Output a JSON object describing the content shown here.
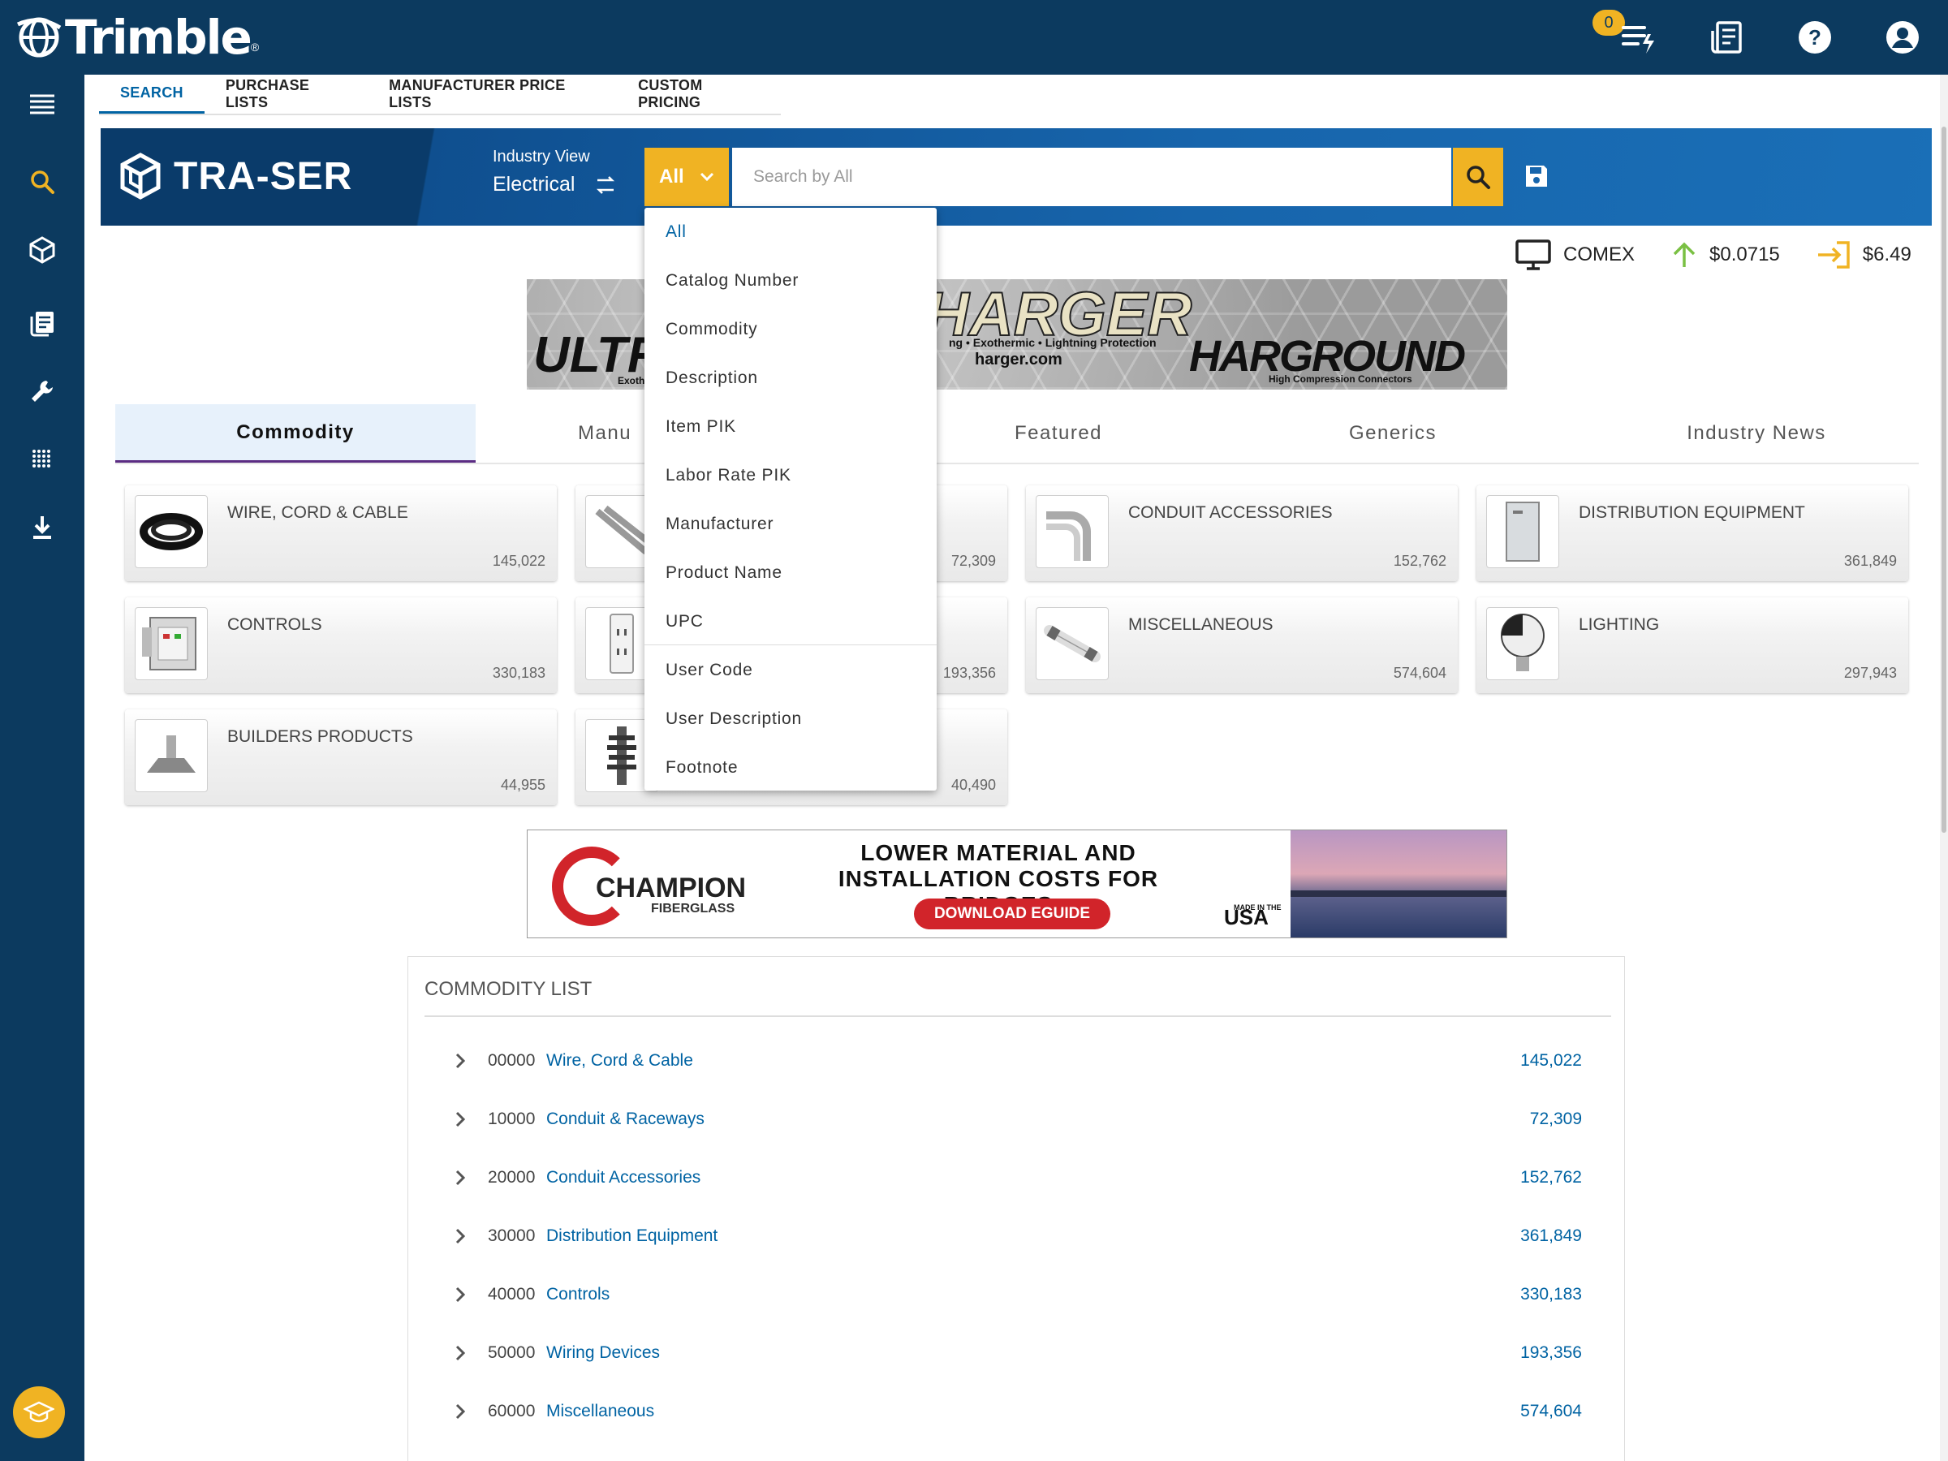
{
  "header": {
    "brand": "Trimble",
    "brand_mark": "®",
    "notification_count": "0",
    "icons": [
      "task-list-icon",
      "news-icon",
      "help-icon",
      "account-icon"
    ]
  },
  "sidebar": {
    "items": [
      "menu-icon",
      "search-icon",
      "cube-icon",
      "catalog-icon",
      "wrench-icon",
      "dots-grid-icon",
      "download-icon"
    ],
    "bottom": "graduation-cap-icon"
  },
  "nav_tabs": [
    {
      "label": "SEARCH",
      "active": true
    },
    {
      "label": "PURCHASE LISTS",
      "active": false
    },
    {
      "label": "MANUFACTURER PRICE LISTS",
      "active": false
    },
    {
      "label": "CUSTOM PRICING",
      "active": false
    }
  ],
  "banner": {
    "brand": "TRA-SER",
    "industry_label": "Industry View",
    "industry_value": "Electrical",
    "scope": "All",
    "search_placeholder": "Search by All"
  },
  "ticker": {
    "comex_label": "COMEX",
    "copper_price": "$0.0715",
    "other_price": "$6.49"
  },
  "dropdown": {
    "selected": "All",
    "options": [
      "All",
      "Catalog Number",
      "Commodity",
      "Description",
      "Item PIK",
      "Labor Rate PIK",
      "Manufacturer",
      "Product Name",
      "UPC",
      "User Code",
      "User Description",
      "Footnote"
    ]
  },
  "ads": {
    "top": {
      "left_word": "ULTR",
      "center_word": "HARGER",
      "center_tagline": "ng • Exothermic • Lightning Protection",
      "center_url": "harger.com",
      "right_word": "HARGROUND",
      "right_tagline": "High Compression Connectors",
      "cut_text": "Exoth"
    },
    "bottom": {
      "brand": "CHAMPION",
      "brand_sub": "FIBERGLASS",
      "headline": "LOWER MATERIAL AND INSTALLATION COSTS FOR BRIDGES",
      "cta": "DOWNLOAD EGUIDE",
      "made_in": "MADE IN THE",
      "usa": "USA"
    }
  },
  "category_tabs": [
    {
      "label": "Commodity",
      "active": true
    },
    {
      "label": "Manu",
      "active": false
    },
    {
      "label": "Featured",
      "active": false
    },
    {
      "label": "Generics",
      "active": false
    },
    {
      "label": "Industry News",
      "active": false
    }
  ],
  "cards": [
    {
      "name": "WIRE, CORD & CABLE",
      "count": "145,022",
      "icon": "wire-coil-icon"
    },
    {
      "name": "",
      "count": "72,309",
      "icon": "conduit-icon"
    },
    {
      "name": "CONDUIT ACCESSORIES",
      "count": "152,762",
      "icon": "conduit-elbow-icon"
    },
    {
      "name": "DISTRIBUTION EQUIPMENT",
      "count": "361,849",
      "icon": "panel-cabinet-icon"
    },
    {
      "name": "CONTROLS",
      "count": "330,183",
      "icon": "control-box-icon"
    },
    {
      "name": "",
      "count": "193,356",
      "icon": "outlet-icon"
    },
    {
      "name": "MISCELLANEOUS",
      "count": "574,604",
      "icon": "fuse-icon"
    },
    {
      "name": "LIGHTING",
      "count": "297,943",
      "icon": "light-bulb-icon"
    },
    {
      "name": "BUILDERS PRODUCTS",
      "count": "44,955",
      "icon": "vent-hood-icon"
    },
    {
      "name": "",
      "count": "40,490",
      "icon": "insulator-icon"
    }
  ],
  "commodity_list": {
    "title": "COMMODITY LIST",
    "rows": [
      {
        "code": "00000",
        "label": "Wire, Cord & Cable",
        "count": "145,022"
      },
      {
        "code": "10000",
        "label": "Conduit & Raceways",
        "count": "72,309"
      },
      {
        "code": "20000",
        "label": "Conduit Accessories",
        "count": "152,762"
      },
      {
        "code": "30000",
        "label": "Distribution Equipment",
        "count": "361,849"
      },
      {
        "code": "40000",
        "label": "Controls",
        "count": "330,183"
      },
      {
        "code": "50000",
        "label": "Wiring Devices",
        "count": "193,356"
      },
      {
        "code": "60000",
        "label": "Miscellaneous",
        "count": "574,604"
      }
    ]
  },
  "colors": {
    "nav": "#0c3a5f",
    "accent": "#f0b323",
    "link": "#0063a3",
    "banner": "#1765ac"
  }
}
